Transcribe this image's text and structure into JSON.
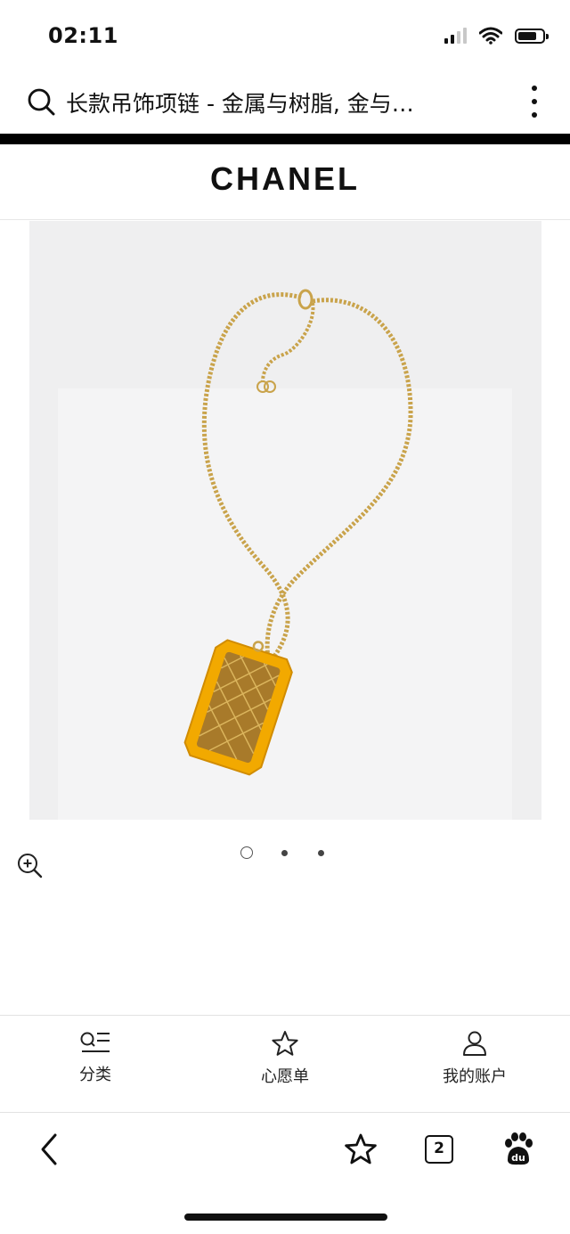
{
  "status_bar": {
    "time": "02:11"
  },
  "search": {
    "query": "长款吊饰项链 - 金属与树脂, 金与…"
  },
  "brand": {
    "logo": "CHANEL"
  },
  "carousel": {
    "slides": 3,
    "active_index": 0
  },
  "bottom_nav": {
    "items": [
      {
        "label": "分类",
        "icon": "category-list-icon"
      },
      {
        "label": "心愿单",
        "icon": "star-icon"
      },
      {
        "label": "我的账户",
        "icon": "user-icon"
      }
    ]
  },
  "toolbar": {
    "tab_count": "2"
  },
  "colors": {
    "pendant": "#f2a900",
    "chain": "#c9a34b",
    "image_bg": "#efeff0"
  }
}
